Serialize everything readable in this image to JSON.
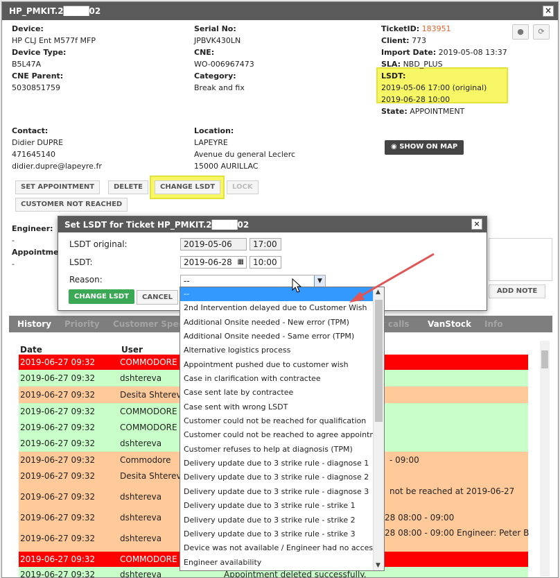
{
  "window": {
    "title": "HP_PMKIT.2████02"
  },
  "device": {
    "device_label": "Device:",
    "device_value": "HP CLJ Ent M577f MFP",
    "type_label": "Device Type:",
    "type_value": "B5L47A",
    "cne_parent_label": "CNE Parent:",
    "cne_parent_value": "5030851759"
  },
  "serial": {
    "serial_label": "Serial No:",
    "serial_value": "JPBVK430LN",
    "cne_label": "CNE:",
    "cne_value": "WO-006967473",
    "category_label": "Category:",
    "category_value": "Break and fix"
  },
  "ticket": {
    "id_label": "TicketID:",
    "id_value": "183951",
    "client_label": "Client:",
    "client_value": "773",
    "import_label": "Import Date:",
    "import_value": "2019-05-08 13:37",
    "sla_label": "SLA:",
    "sla_value": "NBD_PLUS",
    "lsdt_label": "LSDT:",
    "lsdt_original": "2019-05-06 17:00 (original)",
    "lsdt_current": "2019-06-28 10:00",
    "state_label": "State:",
    "state_value": "APPOINTMENT"
  },
  "contact": {
    "label": "Contact:",
    "name": "Didier DUPRE",
    "phone": "471645140",
    "email": "didier.dupre@lapeyre.fr"
  },
  "location": {
    "label": "Location:",
    "line1": "LAPEYRE",
    "line2": "Avenue du general Leclerc",
    "line3": "15000 AURILLAC"
  },
  "buttons": {
    "show_on_map": "SHOW ON MAP",
    "set_appointment": "SET APPOINTMENT",
    "delete": "DELETE",
    "change_lsdt": "CHANGE LSDT",
    "lock": "LOCK",
    "customer_not_reached": "CUSTOMER NOT REACHED",
    "add_note": "ADD NOTE"
  },
  "engineer": {
    "label": "Engineer:",
    "value": "-",
    "appointment_label": "Appointme",
    "appointment_value": "-"
  },
  "dialog": {
    "title": "Set LSDT for Ticket HP_PMKIT.2████02",
    "lsdt_original_label": "LSDT original:",
    "orig_date": "2019-05-06",
    "orig_time": "17:00",
    "lsdt_label": "LSDT:",
    "new_date": "2019-06-28",
    "new_time": "10:00",
    "reason_label": "Reason:",
    "reason_value": "--",
    "change_button": "CHANGE LSDT",
    "cancel_button": "CANCEL"
  },
  "reason_options": [
    "--",
    "2nd Intervention delayed due to Customer Wish",
    "Additional Onsite needed - New error (TPM)",
    "Additional Onsite needed - Same error (TPM)",
    "Alternative logistics process",
    "Appointment pushed due to customer wish",
    "Case in clarification with contractee",
    "Case sent late by contractee",
    "Case sent with wrong LSDT",
    "Customer could not be reached for qualification",
    "Customer could not be reached to agree appointment",
    "Customer refuses to help at diagnosis (TPM)",
    "Delivery update due to 3 strike rule - diagnose 1",
    "Delivery update due to 3 strike rule - diagnose 2",
    "Delivery update due to 3 strike rule - diagnose 3",
    "Delivery update due to 3 strike rule - strike 1",
    "Delivery update due to 3 strike rule - strike 2",
    "Delivery update due to 3 strike rule - strike 3",
    "Device was not available / Engineer had no access",
    "Engineer availability"
  ],
  "tabs": [
    "History",
    "Priority",
    "Customer Spec",
    "t calls",
    "VanStock",
    "Info"
  ],
  "history": {
    "col_date": "Date",
    "col_user": "User",
    "rows": [
      {
        "date": "2019-06-27 09:32",
        "user": "COMMODORE",
        "text": ""
      },
      {
        "date": "2019-06-27 09:32",
        "user": "dshtereva",
        "text": ""
      },
      {
        "date": "2019-06-27 09:32",
        "user": "Desita Shtereva",
        "text": ""
      },
      {
        "date": "2019-06-27 09:32",
        "user": "COMMODORE",
        "text": ""
      },
      {
        "date": "2019-06-27 09:32",
        "user": "COMMODORE",
        "text": ""
      },
      {
        "date": "2019-06-27 09:32",
        "user": "dshtereva",
        "text": ""
      },
      {
        "date": "2019-06-27 09:32",
        "user": "Commodore",
        "text": "- 09:00"
      },
      {
        "date": "2019-06-27 09:32",
        "user": "Desita Shtereva",
        "text": ""
      },
      {
        "date": "2019-06-27 09:32",
        "user": "dshtereva",
        "text": "not be reached at 2019-06-27"
      },
      {
        "date": "2019-06-27 09:32",
        "user": "dshtereva",
        "text": "28 08:00 - 09:00"
      },
      {
        "date": "2019-06-27 09:32",
        "user": "dshtereva",
        "text": "28 08:00 - 09:00 Engineer: Peter B"
      },
      {
        "date": "2019-06-27 09:32",
        "user": "COMMODORE",
        "text": ""
      },
      {
        "date": "2019-06-27 09:32",
        "user": "dshtereva",
        "text": "Appointment deleted successfully."
      }
    ]
  }
}
